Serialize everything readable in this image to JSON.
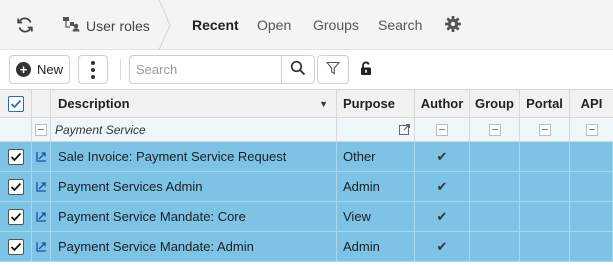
{
  "nav": {
    "refresh_icon": "refresh-icon",
    "section_icon": "user-roles-icon",
    "section_label": "User roles",
    "tabs": [
      {
        "label": "Recent",
        "active": true
      },
      {
        "label": "Open",
        "active": false
      },
      {
        "label": "Groups",
        "active": false
      },
      {
        "label": "Search",
        "active": false
      }
    ],
    "settings_icon": "gear-icon"
  },
  "toolbar": {
    "new_label": "New",
    "more_icon": "vertical-ellipsis-icon",
    "search_placeholder": "Search",
    "search_value": "",
    "search_icon": "magnifier-icon",
    "filter_icon": "funnel-icon",
    "lock_icon": "unlock-icon"
  },
  "grid": {
    "columns": [
      "Description",
      "Purpose",
      "Author",
      "Group",
      "Portal",
      "API"
    ],
    "sort_indicator": "▼",
    "filter_row": {
      "description": "Payment Service"
    },
    "rows": [
      {
        "description": "Sale Invoice: Payment Service Request",
        "purpose": "Other",
        "author": "✔"
      },
      {
        "description": "Payment Services Admin",
        "purpose": "Admin",
        "author": "✔"
      },
      {
        "description": "Payment Service Mandate: Core",
        "purpose": "View",
        "author": "✔"
      },
      {
        "description": "Payment Service Mandate: Admin",
        "purpose": "Admin",
        "author": "✔"
      }
    ]
  },
  "colors": {
    "selected_row": "#7cc3e6",
    "header_bg": "#f1f1f1",
    "filter_row_bg": "#eef8fb",
    "accent": "#2a6fb2"
  }
}
